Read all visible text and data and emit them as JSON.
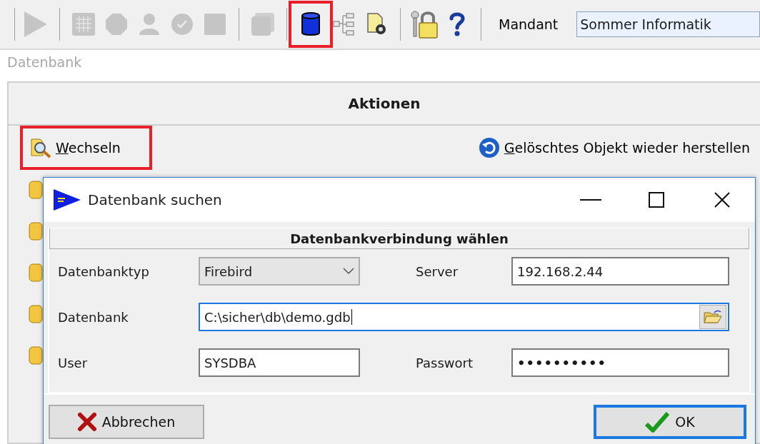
{
  "toolbar": {
    "groups": [
      [
        {
          "kind": "play",
          "disabled": true,
          "highlighted": false
        }
      ],
      [
        {
          "kind": "grid",
          "disabled": true,
          "highlighted": false
        },
        {
          "kind": "octagon",
          "disabled": true,
          "highlighted": false
        },
        {
          "kind": "person",
          "disabled": true,
          "highlighted": false
        },
        {
          "kind": "check",
          "disabled": true,
          "highlighted": false
        },
        {
          "kind": "square",
          "disabled": true,
          "highlighted": false
        }
      ],
      [
        {
          "kind": "stack",
          "disabled": true,
          "highlighted": false
        }
      ],
      [
        {
          "kind": "database",
          "disabled": false,
          "highlighted": true
        },
        {
          "kind": "tree",
          "disabled": false,
          "highlighted": false
        },
        {
          "kind": "gear",
          "disabled": false,
          "highlighted": false
        }
      ],
      [
        {
          "kind": "lock",
          "disabled": false,
          "highlighted": false
        },
        {
          "kind": "help",
          "disabled": false,
          "highlighted": false
        }
      ]
    ],
    "mandant_label": "Mandant",
    "mandant_value": "Sommer Informatik"
  },
  "section_label": "Datenbank",
  "actions": {
    "title": "Aktionen",
    "items": [
      {
        "kind": "switch",
        "label": "Wechseln",
        "highlighted": true
      },
      {
        "kind": "restore",
        "label": "Gelöschtes Objekt wieder herstellen",
        "highlighted": false
      }
    ]
  },
  "dialog": {
    "title": "Datenbank suchen",
    "group_title": "Datenbankverbindung wählen",
    "fields": [
      {
        "kind": "select",
        "label": "Datenbanktyp",
        "value": "Firebird",
        "focused": false
      },
      {
        "kind": "text",
        "label": "Server",
        "value": "192.168.2.44",
        "focused": false
      },
      {
        "kind": "browse",
        "label": "Datenbank",
        "value": "C:\\sicher\\db\\demo.gdb",
        "focused": true
      },
      {
        "kind": "text",
        "label": "User",
        "value": "SYSDBA",
        "focused": false
      },
      {
        "kind": "password",
        "label": "Passwort",
        "value": "••••••••••",
        "focused": false
      }
    ],
    "buttons": [
      {
        "kind": "cancel",
        "label": "Abbrechen",
        "default": false
      },
      {
        "kind": "ok",
        "label": "OK",
        "default": true
      }
    ]
  }
}
